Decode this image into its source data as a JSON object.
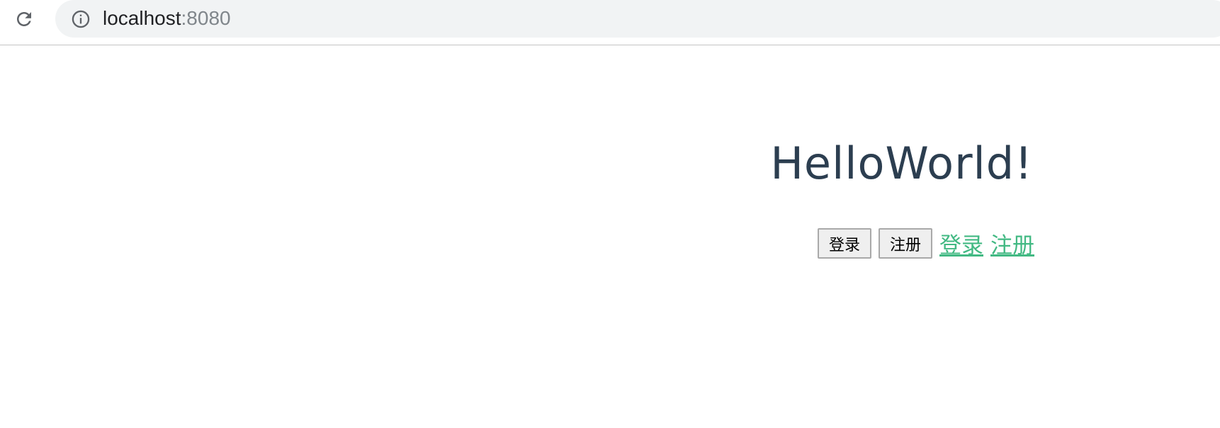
{
  "browser": {
    "reload_icon": "reload-icon",
    "info_icon": "info-icon",
    "url_host": "localhost",
    "url_port": ":8080"
  },
  "page": {
    "heading": "HelloWorld!",
    "buttons": {
      "login": "登录",
      "register": "注册"
    },
    "links": {
      "login": "登录",
      "register": "注册"
    }
  },
  "colors": {
    "heading": "#2c3e50",
    "link": "#42b983",
    "omnibox_bg": "#f1f3f4",
    "port_text": "#80868b"
  }
}
